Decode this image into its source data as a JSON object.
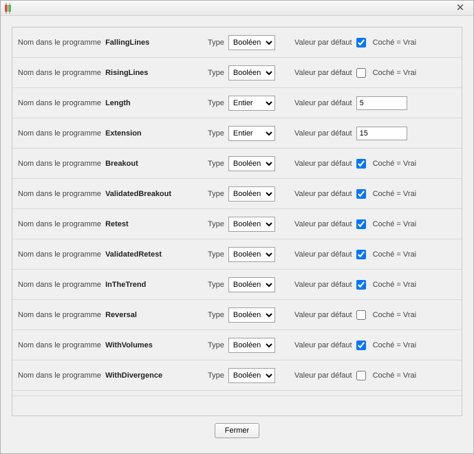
{
  "labels": {
    "name_in_program": "Nom dans le programme",
    "type": "Type",
    "default_value": "Valeur par défaut",
    "checked_equals_true": "Coché = Vrai",
    "close_footer": "Fermer"
  },
  "type_options": {
    "boolean": "Booléen",
    "integer": "Entier"
  },
  "rows": [
    {
      "name": "FallingLines",
      "type": "boolean",
      "value_kind": "bool",
      "checked": true
    },
    {
      "name": "RisingLines",
      "type": "boolean",
      "value_kind": "bool",
      "checked": false
    },
    {
      "name": "Length",
      "type": "integer",
      "value_kind": "int",
      "value": "5"
    },
    {
      "name": "Extension",
      "type": "integer",
      "value_kind": "int",
      "value": "15"
    },
    {
      "name": "Breakout",
      "type": "boolean",
      "value_kind": "bool",
      "checked": true
    },
    {
      "name": "ValidatedBreakout",
      "type": "boolean",
      "value_kind": "bool",
      "checked": true
    },
    {
      "name": "Retest",
      "type": "boolean",
      "value_kind": "bool",
      "checked": true
    },
    {
      "name": "ValidatedRetest",
      "type": "boolean",
      "value_kind": "bool",
      "checked": true
    },
    {
      "name": "InTheTrend",
      "type": "boolean",
      "value_kind": "bool",
      "checked": true
    },
    {
      "name": "Reversal",
      "type": "boolean",
      "value_kind": "bool",
      "checked": false
    },
    {
      "name": "WithVolumes",
      "type": "boolean",
      "value_kind": "bool",
      "checked": true
    },
    {
      "name": "WithDivergence",
      "type": "boolean",
      "value_kind": "bool",
      "checked": false
    }
  ]
}
